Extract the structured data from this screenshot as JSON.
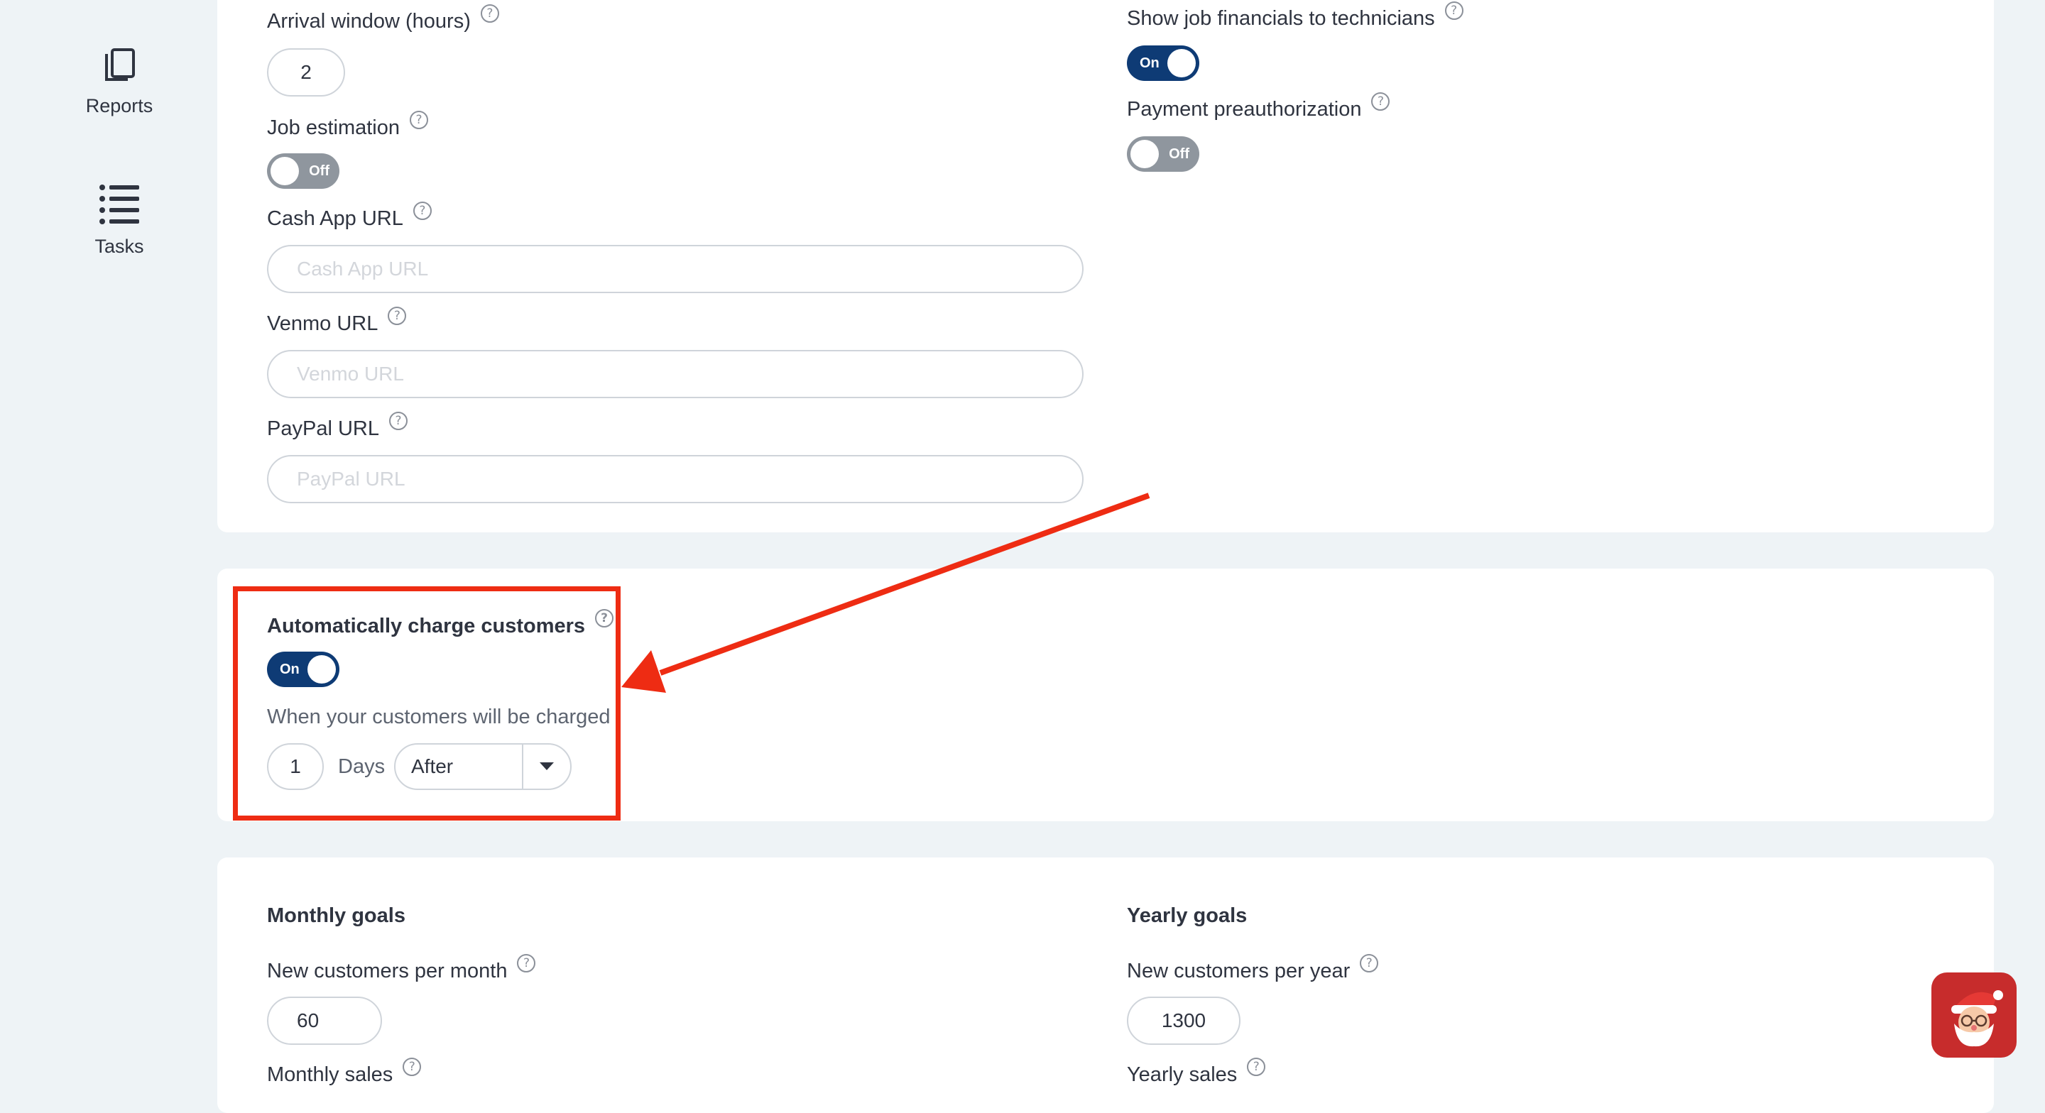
{
  "sidebar": {
    "items": [
      {
        "label": "Reports",
        "icon": "copy-icon"
      },
      {
        "label": "Tasks",
        "icon": "list-icon"
      }
    ]
  },
  "settings": {
    "arrival_window": {
      "label": "Arrival window (hours)",
      "value": "2"
    },
    "job_estimation": {
      "label": "Job estimation",
      "state": "Off"
    },
    "cash_app": {
      "label": "Cash App URL",
      "placeholder": "Cash App URL",
      "value": ""
    },
    "venmo": {
      "label": "Venmo URL",
      "placeholder": "Venmo URL",
      "value": ""
    },
    "paypal": {
      "label": "PayPal URL",
      "placeholder": "PayPal URL",
      "value": ""
    },
    "show_financials": {
      "label": "Show job financials to technicians",
      "state": "On"
    },
    "payment_preauth": {
      "label": "Payment preauthorization",
      "state": "Off"
    }
  },
  "auto_charge": {
    "title": "Automatically charge customers",
    "state": "On",
    "subtitle": "When your customers will be charged",
    "days_value": "1",
    "days_label": "Days",
    "timing": "After"
  },
  "goals": {
    "monthly": {
      "title": "Monthly goals",
      "new_customers_label": "New customers per month",
      "new_customers_value": "60",
      "sales_label": "Monthly sales"
    },
    "yearly": {
      "title": "Yearly goals",
      "new_customers_label": "New customers per year",
      "new_customers_value": "1300",
      "sales_label": "Yearly sales"
    }
  },
  "help_glyph": "?",
  "colors": {
    "toggle_on": "#0e3b75",
    "toggle_off": "#8f969e",
    "annotation": "#ee2c13",
    "background": "#eef3f6"
  }
}
